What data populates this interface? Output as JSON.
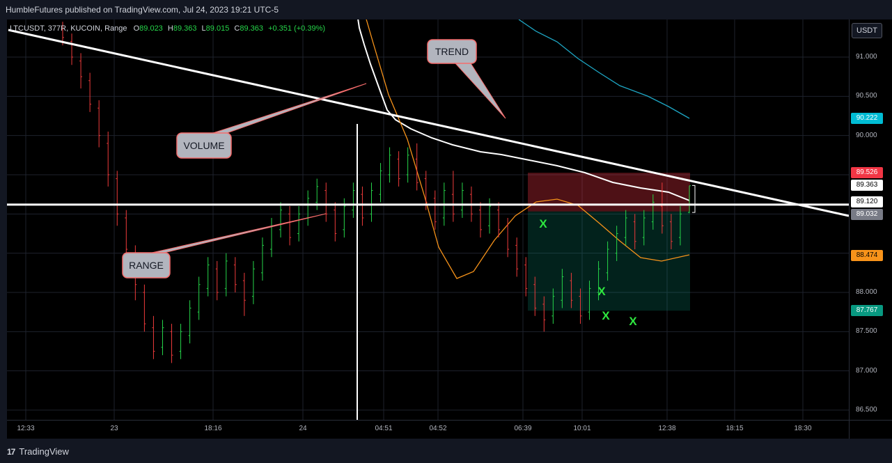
{
  "header": {
    "published": "HumbleFutures published on TradingView.com, Jul 24, 2023 19:21 UTC-5"
  },
  "legend": {
    "symbol": "LTCUSDT, 377R, KUCOIN, Range",
    "o_label": "O",
    "o_value": "89.023",
    "h_label": "H",
    "h_value": "89.363",
    "l_label": "L",
    "l_value": "89.015",
    "c_label": "C",
    "c_value": "89.363",
    "change": "+0.351 (+0.39%)"
  },
  "currency_button": "USDT",
  "footer": {
    "brand": "TradingView",
    "logo_mark": "17"
  },
  "colors": {
    "up": "#26d64a",
    "down": "#ef3b3b",
    "grid": "#1e222d",
    "orange": "#f7931a",
    "cyan": "#1ea7c5",
    "white": "#ffffff"
  },
  "chart_data": {
    "type": "candlestick",
    "symbol": "LTCUSDT",
    "exchange": "KUCOIN",
    "ylim": [
      86.4,
      91.5
    ],
    "y_ticks": [
      "91.000",
      "90.500",
      "90.000",
      "88.000",
      "87.500",
      "87.000",
      "86.500"
    ],
    "x_ticks": [
      "12:33",
      "23",
      "18:16",
      "24",
      "04:51",
      "04:52",
      "06:39",
      "10:01",
      "12:38",
      "18:15",
      "18:30"
    ],
    "price_labels": [
      {
        "text": "90.222",
        "price": 90.222,
        "bg": "#00bcd4",
        "fg": "#ffffff"
      },
      {
        "text": "89.526",
        "price": 89.526,
        "bg": "#f23645",
        "fg": "#ffffff"
      },
      {
        "text": "89.363",
        "price": 89.363,
        "bg": "#ffffff",
        "fg": "#000000"
      },
      {
        "text": "89.120",
        "price": 89.12,
        "bg": "#ffffff",
        "fg": "#000000"
      },
      {
        "text": "89.032",
        "price": 89.032,
        "bg": "#787b86",
        "fg": "#ffffff"
      },
      {
        "text": "88.474",
        "price": 88.474,
        "bg": "#f7931a",
        "fg": "#000000"
      },
      {
        "text": "87.767",
        "price": 87.767,
        "bg": "#089981",
        "fg": "#ffffff"
      }
    ],
    "annotations": [
      {
        "text": "TREND"
      },
      {
        "text": "VOLUME"
      },
      {
        "text": "RANGE"
      }
    ],
    "markers": [
      "X",
      "X",
      "X",
      "X"
    ],
    "horizontal_level": 89.12,
    "position_box": {
      "entry": 89.032,
      "stop": 89.526,
      "target": 87.767
    },
    "candles": [
      {
        "o": 91.35,
        "c": 91.25,
        "h": 91.45,
        "l": 91.15
      },
      {
        "o": 91.2,
        "c": 91.0,
        "h": 91.3,
        "l": 90.9
      },
      {
        "o": 90.95,
        "c": 90.75,
        "h": 91.05,
        "l": 90.6
      },
      {
        "o": 90.7,
        "c": 90.4,
        "h": 90.8,
        "l": 90.3
      },
      {
        "o": 90.35,
        "c": 90.0,
        "h": 90.45,
        "l": 89.85
      },
      {
        "o": 89.9,
        "c": 89.5,
        "h": 90.05,
        "l": 89.35
      },
      {
        "o": 89.45,
        "c": 89.0,
        "h": 89.55,
        "l": 88.85
      },
      {
        "o": 88.95,
        "c": 88.55,
        "h": 89.05,
        "l": 88.4
      },
      {
        "o": 88.5,
        "c": 88.1,
        "h": 88.6,
        "l": 87.9
      },
      {
        "o": 88.0,
        "c": 87.6,
        "h": 88.1,
        "l": 87.5
      },
      {
        "o": 87.55,
        "c": 87.25,
        "h": 87.7,
        "l": 87.15
      },
      {
        "o": 87.3,
        "c": 87.55,
        "h": 87.65,
        "l": 87.2
      },
      {
        "o": 87.5,
        "c": 87.2,
        "h": 87.6,
        "l": 87.1
      },
      {
        "o": 87.25,
        "c": 87.5,
        "h": 87.6,
        "l": 87.15
      },
      {
        "o": 87.45,
        "c": 87.8,
        "h": 87.9,
        "l": 87.35
      },
      {
        "o": 87.75,
        "c": 88.1,
        "h": 88.2,
        "l": 87.65
      },
      {
        "o": 88.05,
        "c": 88.35,
        "h": 88.45,
        "l": 87.95
      },
      {
        "o": 88.3,
        "c": 88.0,
        "h": 88.4,
        "l": 87.9
      },
      {
        "o": 88.05,
        "c": 88.4,
        "h": 88.5,
        "l": 87.95
      },
      {
        "o": 88.35,
        "c": 88.1,
        "h": 88.45,
        "l": 88.0
      },
      {
        "o": 88.15,
        "c": 87.9,
        "h": 88.25,
        "l": 87.7
      },
      {
        "o": 87.95,
        "c": 88.3,
        "h": 88.4,
        "l": 87.85
      },
      {
        "o": 88.25,
        "c": 88.6,
        "h": 88.7,
        "l": 88.15
      },
      {
        "o": 88.55,
        "c": 88.85,
        "h": 88.95,
        "l": 88.45
      },
      {
        "o": 88.8,
        "c": 89.05,
        "h": 89.15,
        "l": 88.7
      },
      {
        "o": 89.0,
        "c": 88.7,
        "h": 89.1,
        "l": 88.6
      },
      {
        "o": 88.75,
        "c": 89.0,
        "h": 89.1,
        "l": 88.65
      },
      {
        "o": 88.95,
        "c": 89.2,
        "h": 89.3,
        "l": 88.85
      },
      {
        "o": 89.15,
        "c": 89.35,
        "h": 89.45,
        "l": 89.05
      },
      {
        "o": 89.3,
        "c": 89.0,
        "h": 89.4,
        "l": 88.9
      },
      {
        "o": 89.05,
        "c": 88.75,
        "h": 89.15,
        "l": 88.65
      },
      {
        "o": 88.8,
        "c": 89.1,
        "h": 89.2,
        "l": 88.7
      },
      {
        "o": 89.05,
        "c": 89.3,
        "h": 89.4,
        "l": 88.95
      },
      {
        "o": 89.25,
        "c": 88.95,
        "h": 89.35,
        "l": 88.85
      },
      {
        "o": 89.0,
        "c": 89.3,
        "h": 89.4,
        "l": 88.9
      },
      {
        "o": 89.25,
        "c": 89.55,
        "h": 89.65,
        "l": 89.15
      },
      {
        "o": 89.5,
        "c": 89.75,
        "h": 89.85,
        "l": 89.4
      },
      {
        "o": 89.7,
        "c": 89.45,
        "h": 89.8,
        "l": 89.35
      },
      {
        "o": 89.5,
        "c": 89.75,
        "h": 89.85,
        "l": 89.4
      },
      {
        "o": 89.7,
        "c": 89.4,
        "h": 89.9,
        "l": 89.3
      },
      {
        "o": 89.45,
        "c": 89.15,
        "h": 89.55,
        "l": 89.05
      },
      {
        "o": 89.2,
        "c": 88.9,
        "h": 89.3,
        "l": 88.8
      },
      {
        "o": 88.95,
        "c": 89.3,
        "h": 89.4,
        "l": 88.85
      },
      {
        "o": 89.25,
        "c": 89.0,
        "h": 89.55,
        "l": 88.9
      },
      {
        "o": 89.05,
        "c": 89.3,
        "h": 89.4,
        "l": 88.95
      },
      {
        "o": 89.25,
        "c": 89.0,
        "h": 89.35,
        "l": 88.9
      },
      {
        "o": 89.05,
        "c": 88.8,
        "h": 89.15,
        "l": 88.7
      },
      {
        "o": 88.85,
        "c": 89.1,
        "h": 89.2,
        "l": 88.75
      },
      {
        "o": 89.05,
        "c": 88.8,
        "h": 89.15,
        "l": 88.7
      },
      {
        "o": 88.85,
        "c": 88.55,
        "h": 88.95,
        "l": 88.45
      },
      {
        "o": 88.6,
        "c": 88.3,
        "h": 88.7,
        "l": 88.2
      },
      {
        "o": 88.35,
        "c": 88.05,
        "h": 88.45,
        "l": 87.95
      },
      {
        "o": 88.1,
        "c": 87.8,
        "h": 88.2,
        "l": 87.7
      },
      {
        "o": 87.85,
        "c": 87.65,
        "h": 87.95,
        "l": 87.5
      },
      {
        "o": 87.7,
        "c": 87.95,
        "h": 88.05,
        "l": 87.6
      },
      {
        "o": 87.9,
        "c": 88.2,
        "h": 88.3,
        "l": 87.8
      },
      {
        "o": 88.15,
        "c": 87.9,
        "h": 88.25,
        "l": 87.8
      },
      {
        "o": 87.95,
        "c": 87.7,
        "h": 88.05,
        "l": 87.6
      },
      {
        "o": 87.75,
        "c": 88.05,
        "h": 88.15,
        "l": 87.65
      },
      {
        "o": 88.0,
        "c": 88.3,
        "h": 88.4,
        "l": 87.9
      },
      {
        "o": 88.25,
        "c": 88.55,
        "h": 88.65,
        "l": 88.15
      },
      {
        "o": 88.5,
        "c": 88.75,
        "h": 88.85,
        "l": 88.4
      },
      {
        "o": 88.7,
        "c": 88.95,
        "h": 89.05,
        "l": 88.6
      },
      {
        "o": 88.9,
        "c": 88.65,
        "h": 89.0,
        "l": 88.55
      },
      {
        "o": 88.7,
        "c": 88.95,
        "h": 89.05,
        "l": 88.6
      },
      {
        "o": 88.9,
        "c": 89.15,
        "h": 89.25,
        "l": 88.8
      },
      {
        "o": 89.1,
        "c": 88.85,
        "h": 89.4,
        "l": 88.75
      },
      {
        "o": 88.9,
        "c": 88.65,
        "h": 89.0,
        "l": 88.55
      },
      {
        "o": 88.7,
        "c": 89.0,
        "h": 89.1,
        "l": 88.6
      },
      {
        "o": 89.02,
        "c": 89.36,
        "h": 89.36,
        "l": 89.01
      }
    ]
  }
}
